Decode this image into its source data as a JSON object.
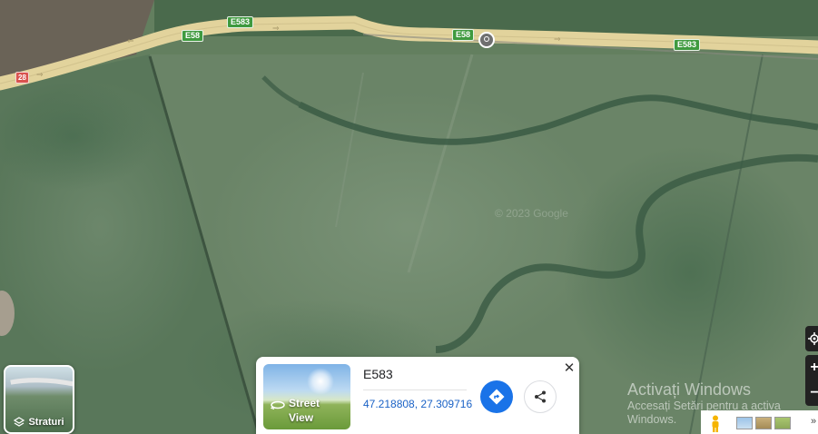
{
  "map": {
    "watermark": "© 2023 Google",
    "road_shields": {
      "e583_left": "E583",
      "e58_left": "E58",
      "e58_mid": "E58",
      "e583_right": "E583",
      "route_28": "28"
    }
  },
  "layers_button": {
    "label": "Straturi"
  },
  "info_card": {
    "street_view_label_line1": "Street",
    "street_view_label_line2": "View",
    "place_name": "E583",
    "coordinates": "47.218808, 27.309716"
  },
  "windows_watermark": {
    "line1": "Activați Windows",
    "line2": "Accesați Setări pentru a activa",
    "line3": "Windows."
  },
  "colors": {
    "road": "#e2d39c",
    "shield_green": "#3f9a3f",
    "shield_red": "#d9534f",
    "directions_blue": "#1a73e8",
    "coords_link": "#1a62c6"
  },
  "icons": {
    "location_pin": "location-pin-icon",
    "layers": "layers-icon",
    "street_view": "street-view-360-icon",
    "directions": "directions-icon",
    "share": "share-icon",
    "close": "close-icon",
    "my_location": "my-location-icon",
    "zoom_in": "zoom-in-icon",
    "zoom_out": "zoom-out-icon",
    "pegman": "pegman-icon"
  }
}
